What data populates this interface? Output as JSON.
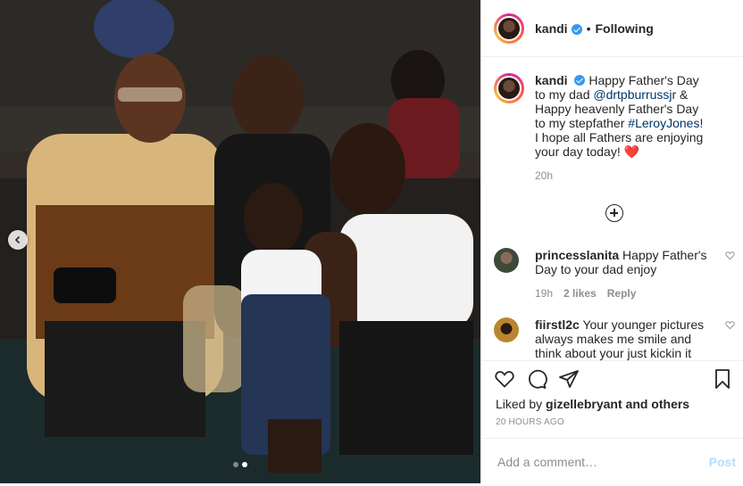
{
  "post": {
    "username": "kandi",
    "separator": "•",
    "follow_status": "Following"
  },
  "caption": {
    "username": "kandi",
    "text_1": "Happy Father's Day to my dad ",
    "mention": "@drtpburrussjr",
    "text_2": " & Happy heavenly Father's Day to my stepfather ",
    "hashtag": "#LeroyJones",
    "text_3": "! I hope all Fathers are enjoying your day today! ",
    "emoji": "❤️",
    "time": "20h"
  },
  "comments": [
    {
      "username": "princesslanita",
      "text": "Happy Father's Day to your dad enjoy",
      "time": "19h",
      "likes": "2 likes",
      "reply": "Reply"
    },
    {
      "username": "fiirstl2c",
      "text": "Your younger pictures always makes me smile and think about your just kickin it"
    }
  ],
  "actions": {
    "liked_prefix": "Liked by ",
    "liked_user": "gizellebryant",
    "liked_suffix": " and others",
    "posted_ago": "20 HOURS AGO"
  },
  "composer": {
    "placeholder": "Add a comment…",
    "post_label": "Post"
  },
  "carousel": {
    "total": 2,
    "current": 2
  },
  "colors": {
    "verified": "#3897f0",
    "link": "#003569",
    "heart": "#ed4956",
    "post_disabled": "#b2dffc"
  },
  "icons": [
    "verified-icon",
    "chevron-left-icon",
    "plus-circle-icon",
    "heart-icon",
    "comment-icon",
    "share-icon",
    "bookmark-icon"
  ]
}
